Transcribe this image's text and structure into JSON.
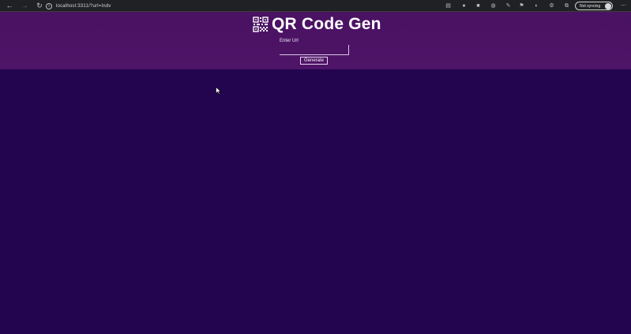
{
  "browser": {
    "url": "localhost:3311/?url=Indv",
    "profile_label": "Not syncing",
    "nav": {
      "back": "←",
      "forward": "→",
      "reload": "↻"
    }
  },
  "app": {
    "title": "QR Code Gen",
    "logo_icon": "qr-code-icon",
    "form": {
      "label": "Enter Url",
      "input_value": "",
      "button_label": "Generate"
    }
  },
  "colors": {
    "page_background": "#23054f",
    "header_background": "#4e1467",
    "text": "#ffffff"
  }
}
